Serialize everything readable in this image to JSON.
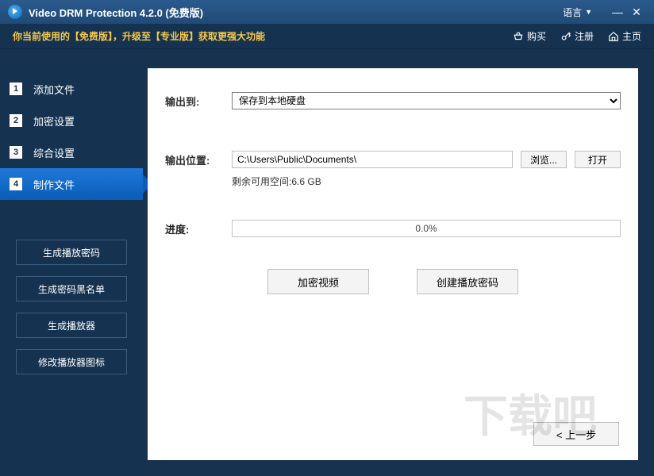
{
  "titlebar": {
    "app_title": "Video DRM Protection 4.2.0 (免费版)",
    "language": "语言"
  },
  "promo": {
    "message": "你当前使用的【免费版】，升级至【专业版】获取更强大功能",
    "buy": "购买",
    "register": "注册",
    "home": "主页"
  },
  "sidebar": {
    "steps": [
      {
        "num": "1",
        "label": "添加文件"
      },
      {
        "num": "2",
        "label": "加密设置"
      },
      {
        "num": "3",
        "label": "综合设置"
      },
      {
        "num": "4",
        "label": "制作文件"
      }
    ],
    "buttons": [
      "生成播放密码",
      "生成密码黑名单",
      "生成播放器",
      "修改播放器图标"
    ]
  },
  "content": {
    "output_to_label": "输出到:",
    "output_to_value": "保存到本地硬盘",
    "output_path_label": "输出位置:",
    "output_path_value": "C:\\Users\\Public\\Documents\\",
    "browse": "浏览...",
    "open": "打开",
    "free_space_label": "剩余可用空间:",
    "free_space_value": "6.6 GB",
    "progress_label": "进度:",
    "progress_value": "0.0%",
    "encrypt_btn": "加密视频",
    "create_pwd_btn": "创建播放密码",
    "prev_btn": "< 上一步"
  },
  "watermark": "下载吧"
}
